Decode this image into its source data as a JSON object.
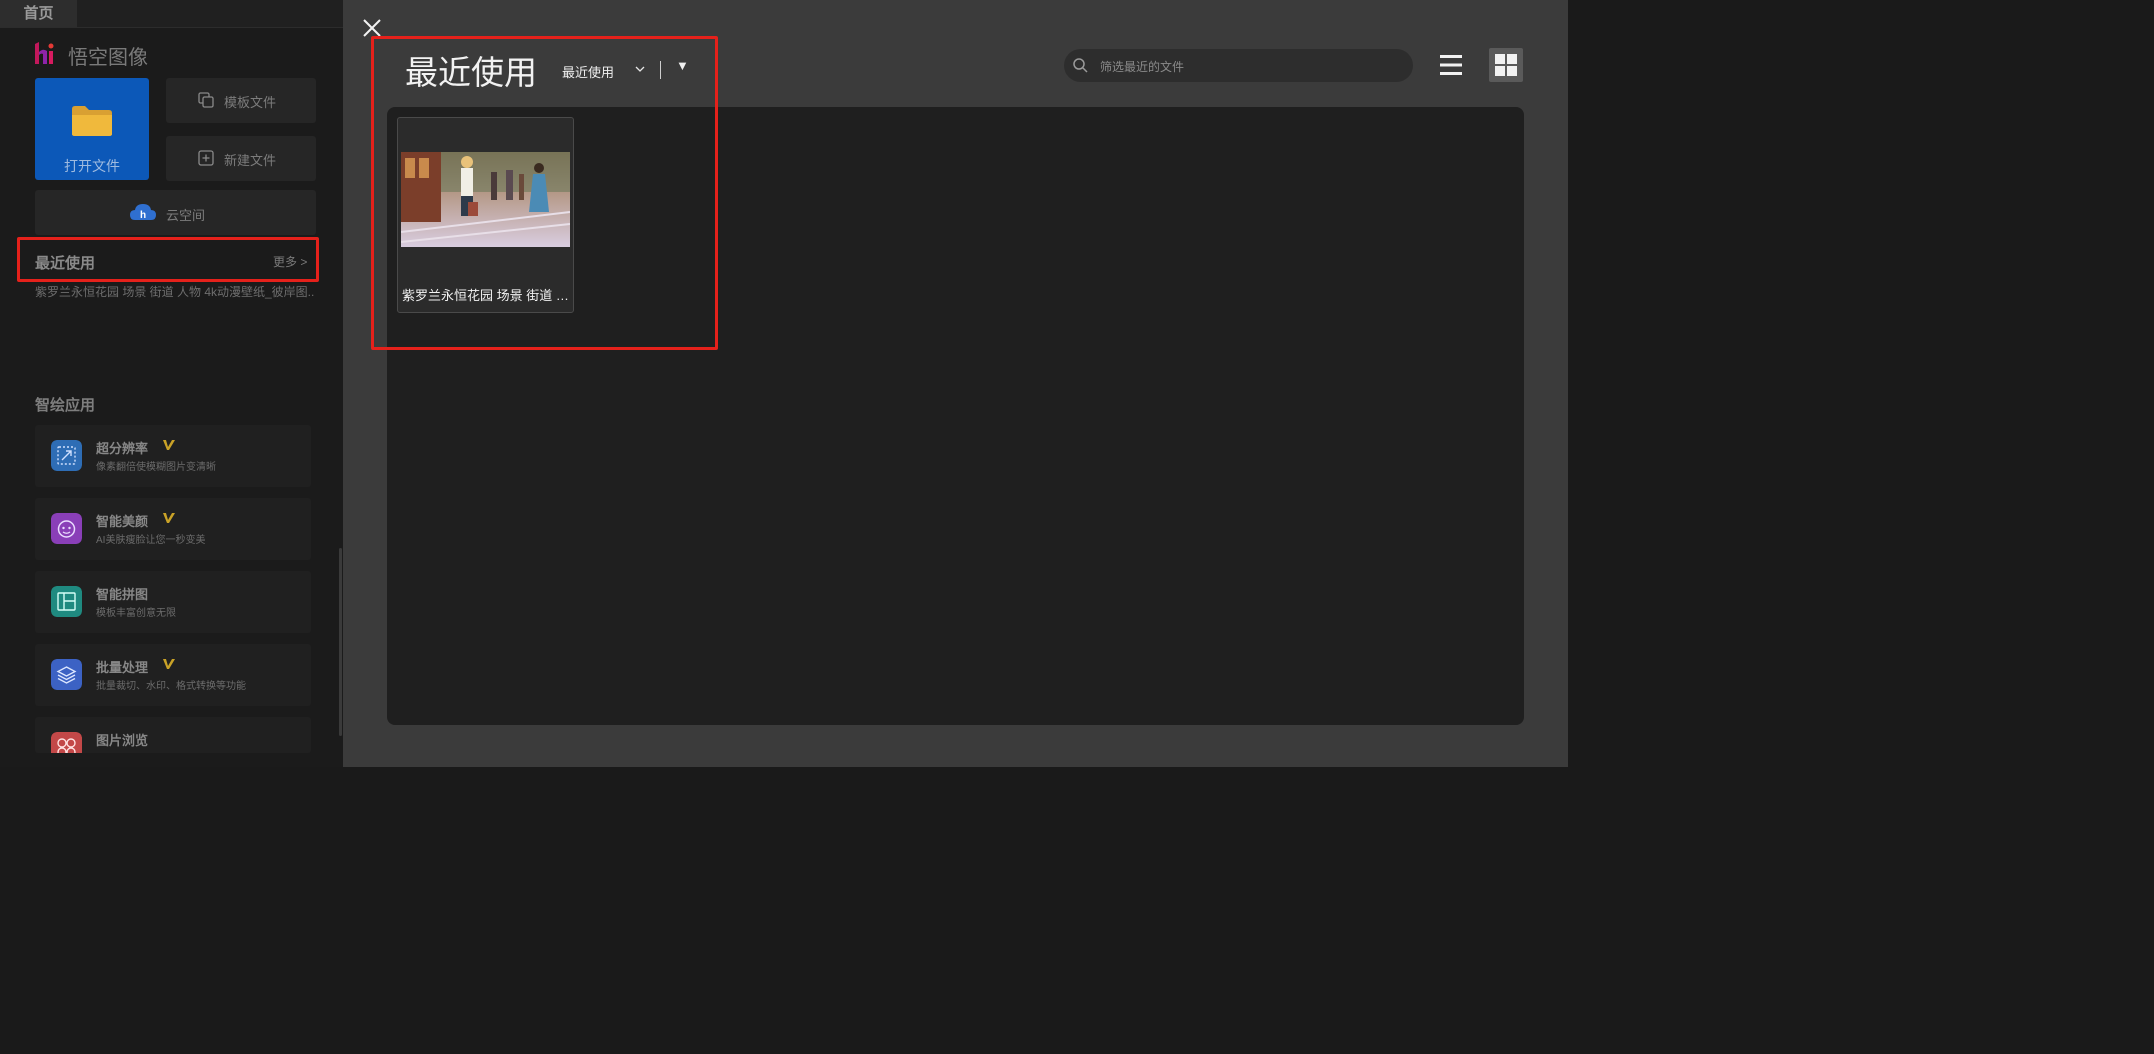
{
  "tabs": {
    "home": "首页"
  },
  "app": {
    "name": "悟空图像",
    "brand_color": "#c2185b"
  },
  "actions": {
    "open_file": "打开文件",
    "template_file": "模板文件",
    "new_file": "新建文件",
    "cloud_space": "云空间"
  },
  "sidebar_recent": {
    "title": "最近使用",
    "more": "更多 >",
    "file": "紫罗兰永恒花园 场景 街道 人物 4k动漫壁纸_彼岸图..."
  },
  "smart_apps": {
    "title": "智绘应用",
    "items": [
      {
        "title": "超分辨率",
        "desc": "像素翻倍使模糊图片变清晰",
        "vip": true,
        "icon": "super-resolution-icon",
        "color": "#2e6db5"
      },
      {
        "title": "智能美颜",
        "desc": "AI美肤瘦脸让您一秒变美",
        "vip": true,
        "icon": "beauty-face-icon",
        "color": "#8a3fb8"
      },
      {
        "title": "智能拼图",
        "desc": "模板丰富创意无限",
        "vip": false,
        "icon": "collage-icon",
        "color": "#1f8a80"
      },
      {
        "title": "批量处理",
        "desc": "批量裁切、水印、格式转换等功能",
        "vip": true,
        "icon": "layers-icon",
        "color": "#3c62c4"
      },
      {
        "title": "图片浏览",
        "desc": "",
        "vip": false,
        "icon": "image-browse-icon",
        "color": "#c34848"
      }
    ]
  },
  "panel": {
    "title": "最近使用",
    "sort_label": "最近使用",
    "sort_arrow": "▼",
    "search_placeholder": "筛选最近的文件",
    "files": [
      {
        "name": "紫罗兰永恒花园 场景 街道 人物 4k动漫壁纸_彼岸图..."
      }
    ]
  },
  "colors": {
    "highlight_border": "#e5211b",
    "accent_blue": "#0c58b8",
    "vip_gold": "#c9a227"
  }
}
